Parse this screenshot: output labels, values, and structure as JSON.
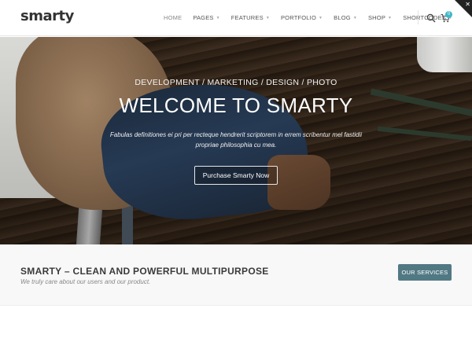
{
  "brand": {
    "logo": "smarty"
  },
  "nav": {
    "items": [
      {
        "label": "HOME",
        "active": true
      },
      {
        "label": "PAGES"
      },
      {
        "label": "FEATURES"
      },
      {
        "label": "PORTFOLIO"
      },
      {
        "label": "BLOG"
      },
      {
        "label": "SHOP"
      },
      {
        "label": "SHORTCODES"
      }
    ],
    "cart_count": "0"
  },
  "hero": {
    "kicker": "DEVELOPMENT / MARKETING / DESIGN / PHOTO",
    "title": "WELCOME TO SMARTY",
    "text_line1": "Fabulas definitiones ei pri per recteque hendrerit scriptorem in errem scribentur mel fastidii",
    "text_line2": "propriae philosophia cu mea.",
    "button_label": "Purchase Smarty Now"
  },
  "callout": {
    "title": "SMARTY – CLEAN AND POWERFUL MULTIPURPOSE",
    "subtitle": "We truly care about our users and our product.",
    "button_label": "OUR SERVICES"
  },
  "colors": {
    "accent": "#517984",
    "badge": "#3fb8c7",
    "header_bg": "#ffffff",
    "callout_bg": "#f8f8f8"
  },
  "icons": {
    "search": "search-icon",
    "cart": "cart-icon",
    "corner": "close-icon"
  }
}
